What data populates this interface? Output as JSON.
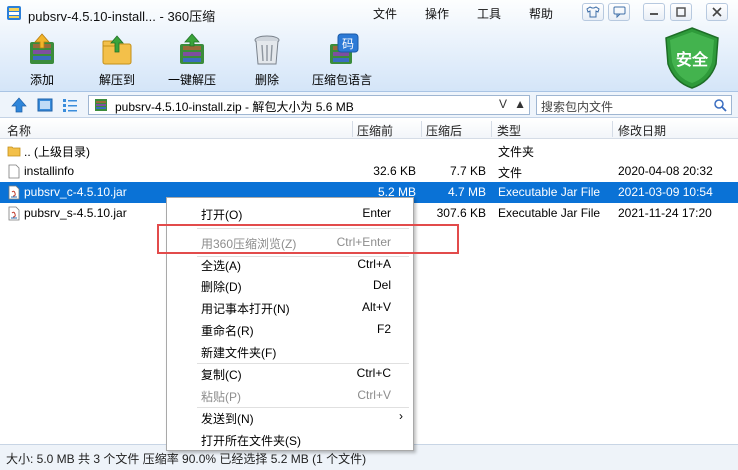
{
  "window": {
    "title": "pubsrv-4.5.10-install... - 360压缩",
    "menus": [
      "文件",
      "操作",
      "工具",
      "帮助"
    ],
    "controls": [
      "shirt-icon",
      "chat-icon",
      "minimize-icon",
      "maximize-icon",
      "close-icon"
    ]
  },
  "toolbar": {
    "buttons": [
      {
        "label": "添加",
        "icon": "add-archive-icon"
      },
      {
        "label": "解压到",
        "icon": "extract-to-icon"
      },
      {
        "label": "一键解压",
        "icon": "one-click-extract-icon"
      },
      {
        "label": "删除",
        "icon": "trash-icon"
      },
      {
        "label": "压缩包语言",
        "icon": "archive-language-icon"
      }
    ],
    "safe_badge": "安全",
    "language_icon_char": "码"
  },
  "address": {
    "path": "pubsrv-4.5.10-install.zip - 解包大小为 5.6 MB",
    "dropdown": "V",
    "up": "▲",
    "search_placeholder": "搜索包内文件"
  },
  "columns": [
    "名称",
    "压缩前",
    "压缩后",
    "类型",
    "修改日期"
  ],
  "rows": [
    {
      "name": ".. (上级目录)",
      "before": "",
      "after": "",
      "type": "文件夹",
      "date": "",
      "icon": "folder-icon"
    },
    {
      "name": "installinfo",
      "before": "32.6 KB",
      "after": "7.7 KB",
      "type": "文件",
      "date": "2020-04-08 20:32",
      "icon": "file-icon"
    },
    {
      "name": "pubsrv_c-4.5.10.jar",
      "before": "5.2 MB",
      "after": "4.7 MB",
      "type": "Executable Jar File",
      "date": "2021-03-09 10:54",
      "icon": "jar-icon",
      "selected": true
    },
    {
      "name": "pubsrv_s-4.5.10.jar",
      "before": "",
      "after": "307.6 KB",
      "type": "Executable Jar File",
      "date": "2021-11-24 17:20",
      "icon": "jar-icon"
    }
  ],
  "context_menu": [
    {
      "label": "打开(O)",
      "key": "Enter"
    },
    {
      "label": "用360压缩浏览(Z)",
      "key": "Ctrl+Enter",
      "disabled": true
    },
    {
      "label": "全选(A)",
      "key": "Ctrl+A"
    },
    {
      "label": "删除(D)",
      "key": "Del"
    },
    {
      "label": "用记事本打开(N)",
      "key": "Alt+V"
    },
    {
      "label": "重命名(R)",
      "key": "F2"
    },
    {
      "label": "新建文件夹(F)",
      "key": ""
    },
    {
      "label": "复制(C)",
      "key": "Ctrl+C"
    },
    {
      "label": "粘贴(P)",
      "key": "Ctrl+V",
      "disabled": true
    },
    {
      "label": "发送到(N)",
      "key": "",
      "submenu": "›"
    },
    {
      "label": "打开所在文件夹(S)",
      "key": ""
    }
  ],
  "status": {
    "text": "大小: 5.0 MB 共 3 个文件 压缩率 90.0% 已经选择 5.2 MB (1 个文件)"
  }
}
